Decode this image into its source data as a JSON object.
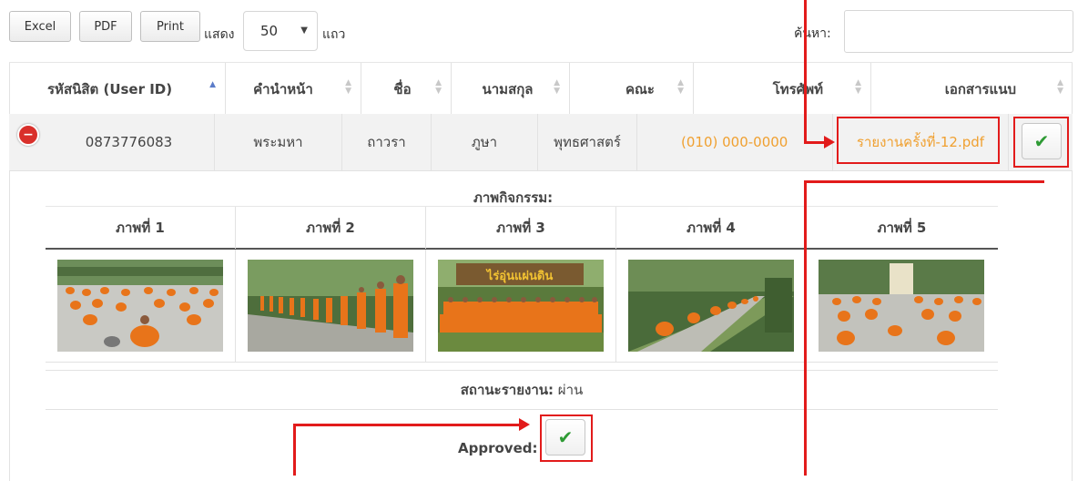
{
  "toolbar": {
    "excel_label": "Excel",
    "pdf_label": "PDF",
    "print_label": "Print",
    "show_label": "แสดง",
    "page_size": "50",
    "rows_label": "แถว",
    "search_label": "ค้นหา:",
    "search_value": ""
  },
  "table": {
    "columns": [
      "รหัสนิสิต (User ID)",
      "คำนำหน้า",
      "ชื่อ",
      "นามสกุล",
      "คณะ",
      "โทรศัพท์",
      "เอกสารแนบ"
    ],
    "row": {
      "user_id": "0873776083",
      "prefix": "พระมหา",
      "first_name": "ถาวรา",
      "last_name": "ภูษา",
      "faculty": "พุทธศาสตร์",
      "phone": "(010) 000-0000",
      "attachment": "รายงานครั้งที่-12.pdf"
    }
  },
  "details": {
    "activity_caption": "ภาพกิจกรรม:",
    "photo_headers": [
      "ภาพที่ 1",
      "ภาพที่ 2",
      "ภาพที่ 3",
      "ภาพที่ 4",
      "ภาพที่ 5"
    ],
    "photo3_sign": "ไร่อุ่นแผ่นดิน",
    "status_label": "สถานะรายงาน:",
    "status_value": "ผ่าน",
    "approved_label": "Approved:"
  },
  "colors": {
    "accent_red": "#e21b1b",
    "link_orange": "#f0a030",
    "check_green": "#2f9b35",
    "robe_orange": "#e8741a"
  },
  "icons": {
    "sort": "sort-arrows-icon",
    "check": "check-icon",
    "collapse": "minus-circle-icon",
    "select_caret": "caret-down-icon"
  }
}
